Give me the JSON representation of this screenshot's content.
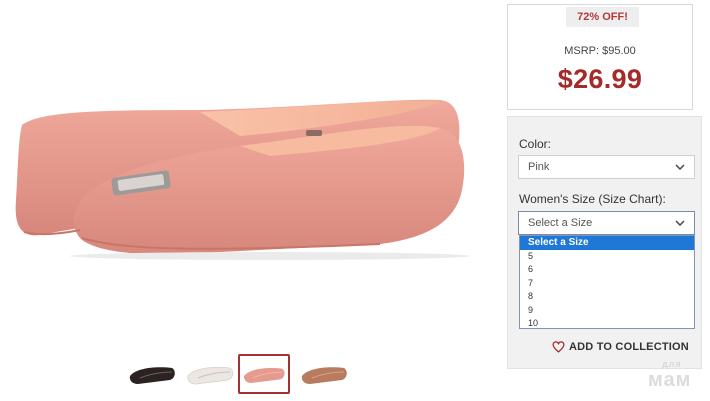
{
  "product": {
    "thumbnails": [
      {
        "name": "black-flat",
        "color": "#2a2321"
      },
      {
        "name": "white-flat",
        "color": "#f2eeea"
      },
      {
        "name": "pink-flat",
        "color": "#e59b90",
        "selected": true
      },
      {
        "name": "bronze-flat",
        "color": "#b87b5e"
      }
    ]
  },
  "price": {
    "discount": "72% OFF!",
    "msrp": "MSRP: $95.00",
    "current": "$26.99"
  },
  "options": {
    "color_label": "Color:",
    "color_value": "Pink",
    "size_label": "Women's Size (Size Chart):",
    "size_value": "Select a Size",
    "size_options": [
      "Select a Size",
      "5",
      "6",
      "7",
      "8",
      "9",
      "10"
    ]
  },
  "collection": {
    "label": "ADD TO COLLECTION",
    "icon": "heart-icon"
  },
  "watermark": {
    "small": "для",
    "big": "мам"
  },
  "colors": {
    "accent": "#a52a2a",
    "badge_text": "#b33939",
    "dropdown_highlight": "#1f78d6",
    "shoe_pink": "#e59b90"
  }
}
